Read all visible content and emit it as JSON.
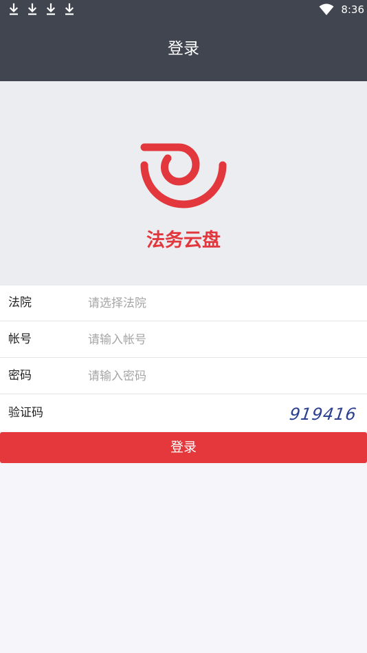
{
  "status_bar": {
    "time": "8:36",
    "download_icons": [
      "download-icon",
      "download-icon",
      "download-icon",
      "download-icon"
    ],
    "wifi_icon": "wifi-icon"
  },
  "app_bar": {
    "title": "登录"
  },
  "hero": {
    "logo_icon": "app-logo",
    "app_name": "法务云盘",
    "brand_color": "#e2373d"
  },
  "form": {
    "court": {
      "label": "法院",
      "placeholder": "请选择法院",
      "value": ""
    },
    "account": {
      "label": "帐号",
      "placeholder": "请输入帐号",
      "value": ""
    },
    "password": {
      "label": "密码",
      "placeholder": "请输入密码",
      "value": ""
    },
    "captcha": {
      "label": "验证码",
      "code": "919416"
    }
  },
  "actions": {
    "login_label": "登录",
    "button_color": "#e5383d"
  }
}
